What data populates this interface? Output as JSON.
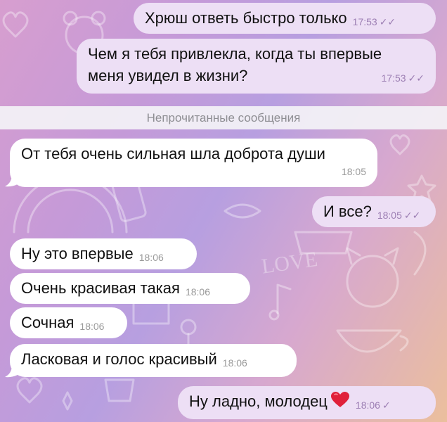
{
  "colors": {
    "outgoing_bubble": "#eddff5",
    "incoming_bubble": "#ffffff",
    "read_check": "#9c7eb3",
    "heart": "#e0203a"
  },
  "messages": [
    {
      "direction": "out",
      "text": "Хрюш ответь быстро только",
      "time": "17:53",
      "status": "read"
    },
    {
      "direction": "out",
      "text": "Чем я тебя привлекла, когда ты впервые меня увидел в жизни?",
      "time": "17:53",
      "status": "read"
    },
    {
      "direction": "in",
      "text": "От тебя очень сильная шла доброта души",
      "time": "18:05"
    },
    {
      "direction": "out",
      "text": "И все?",
      "time": "18:05",
      "status": "read"
    },
    {
      "direction": "in",
      "text": "Ну это впервые",
      "time": "18:06"
    },
    {
      "direction": "in",
      "text": "Очень красивая такая",
      "time": "18:06"
    },
    {
      "direction": "in",
      "text": "Сочная",
      "time": "18:06"
    },
    {
      "direction": "in",
      "text": "Ласковая и голос красивый",
      "time": "18:06"
    },
    {
      "direction": "out",
      "text": "Ну ладно, молодец",
      "emoji": "red-heart",
      "time": "18:06",
      "status": "delivered"
    }
  ],
  "divider": {
    "label": "Непрочитанные сообщения"
  },
  "status_icons": {
    "read": "✓✓",
    "delivered": "✓"
  }
}
